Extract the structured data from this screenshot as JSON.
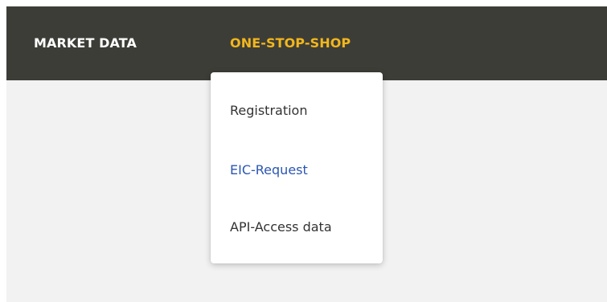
{
  "nav": {
    "items": [
      {
        "label": "MARKET DATA"
      },
      {
        "label": "ONE-STOP-SHOP"
      }
    ]
  },
  "dropdown": {
    "items": [
      {
        "label": "Registration"
      },
      {
        "label": "EIC-Request"
      },
      {
        "label": "API-Access data"
      }
    ]
  },
  "colors": {
    "nav_background": "#3d3d38",
    "nav_text": "#ffffff",
    "nav_active": "#f2b71c",
    "dropdown_link_active": "#2b56b3",
    "dropdown_text": "#333333",
    "page_background": "#f2f2f2"
  }
}
